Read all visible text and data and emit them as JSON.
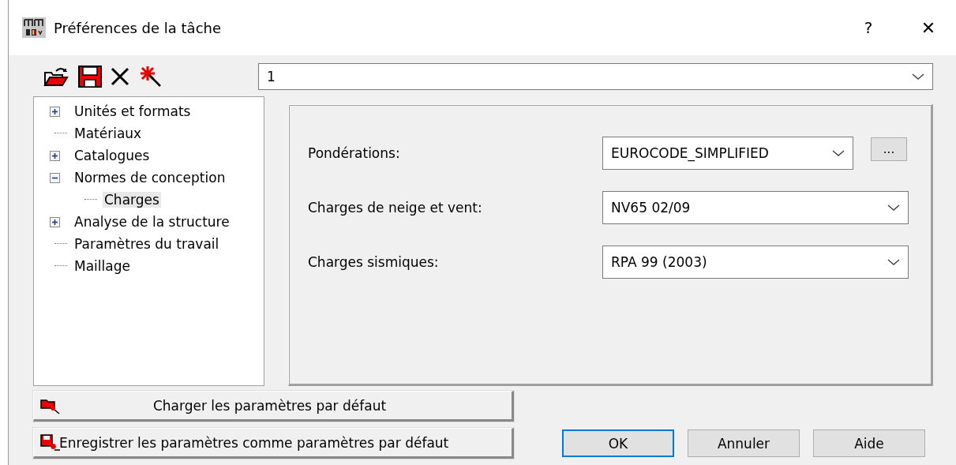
{
  "window": {
    "title": "Préférences de la tâche",
    "help": "?",
    "close": "✕"
  },
  "preset": {
    "value": "1"
  },
  "tree": [
    {
      "label": "Unités et formats",
      "expanded": false,
      "selected": false
    },
    {
      "label": "Matériaux",
      "selected": false
    },
    {
      "label": "Catalogues",
      "expanded": false,
      "selected": false
    },
    {
      "label": "Normes de conception",
      "expanded": true,
      "selected": false,
      "children": [
        {
          "label": "Charges",
          "selected": true
        }
      ]
    },
    {
      "label": "Analyse de la structure",
      "expanded": false,
      "selected": false
    },
    {
      "label": "Paramètres du travail",
      "selected": false
    },
    {
      "label": "Maillage",
      "selected": false
    }
  ],
  "settings": [
    {
      "label": "Pondérations:",
      "value": "EUROCODE_SIMPLIFIED",
      "extra_button": "..."
    },
    {
      "label": "Charges de neige et vent:",
      "value": "NV65 02/09"
    },
    {
      "label": "Charges sismiques:",
      "value": "RPA 99 (2003)"
    }
  ],
  "load_defaults": "Charger les paramètres par défaut",
  "save_defaults": "Enregistrer les paramètres comme paramètres par défaut",
  "buttons": [
    {
      "label": "OK",
      "default": true
    },
    {
      "label": "Annuler",
      "default": false
    },
    {
      "label": "Aide",
      "default": false
    }
  ]
}
